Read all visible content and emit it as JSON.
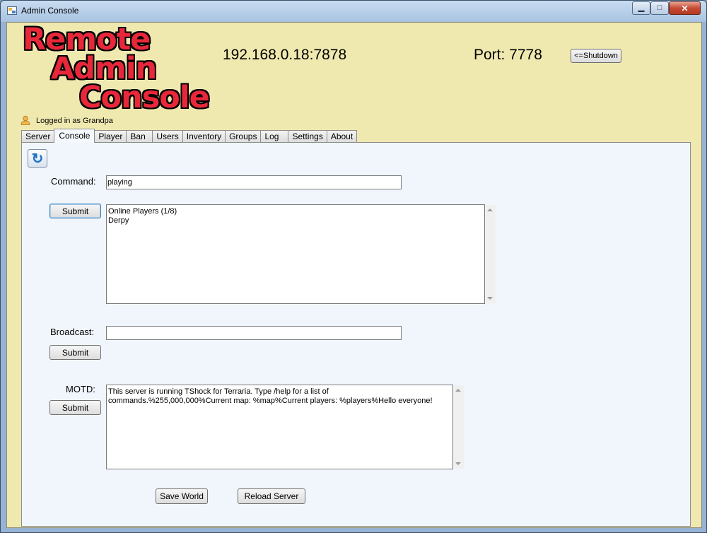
{
  "window": {
    "title": "Admin Console",
    "minimize_glyph": "▁",
    "maximize_glyph": "□",
    "close_glyph": "✕",
    "icon": "app-window-icon"
  },
  "header": {
    "logo_lines": [
      "Remote",
      "Admin",
      "Console"
    ],
    "address": "192.168.0.18:7878",
    "port_text": "Port: 7778",
    "shutdown_label": "<=Shutdown",
    "logged_in_text": "Logged in as Grandpa",
    "user_icon": "user-icon"
  },
  "tabs": [
    {
      "label": "Server"
    },
    {
      "label": "Console",
      "active": true
    },
    {
      "label": "Player"
    },
    {
      "label": "Ban"
    },
    {
      "label": "Users"
    },
    {
      "label": "Inventory"
    },
    {
      "label": "Groups"
    },
    {
      "label": "Log"
    },
    {
      "label": "Settings"
    },
    {
      "label": "About"
    }
  ],
  "console": {
    "refresh_icon": "refresh-icon",
    "command_label": "Command:",
    "command_value": "playing",
    "command_submit": "Submit",
    "output_text": "Online Players (1/8)\nDerpy",
    "broadcast_label": "Broadcast:",
    "broadcast_value": "",
    "broadcast_submit": "Submit",
    "motd_label": "MOTD:",
    "motd_submit": "Submit",
    "motd_text": "This server is running TShock for Terraria. Type /help for a list of commands.%255,000,000%Current map: %map%Current players: %players%Hello everyone!",
    "save_world": "Save World",
    "reload_server": "Reload Server"
  }
}
